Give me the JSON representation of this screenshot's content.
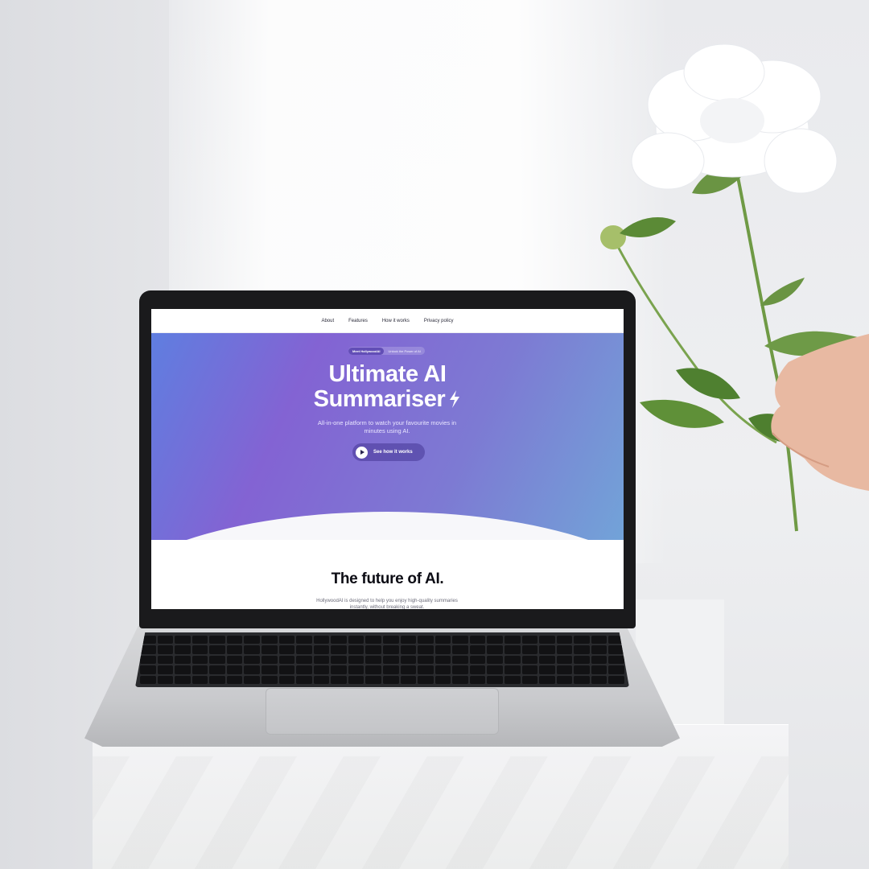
{
  "nav": {
    "items": [
      "About",
      "Features",
      "How it works",
      "Privacy policy"
    ]
  },
  "hero": {
    "badge_pill": "Meet HollywoodAI",
    "badge_text": "Unlock the Power of AI",
    "title_line1": "Ultimate AI",
    "title_line2": "Summariser",
    "subtitle": "All-in-one platform to watch your favourite movies in minutes using AI.",
    "cta_label": "See how it works"
  },
  "section": {
    "title": "The future of AI.",
    "text": "HollywoodAI is designed to help you enjoy high-quality summaries instantly, without breaking a sweat."
  },
  "colors": {
    "hero_start": "#5f7ee0",
    "hero_mid": "#8363d3",
    "hero_end": "#72a3d8",
    "text_dark": "#0c0c14"
  },
  "icons": {
    "bolt": "lightning-bolt-icon",
    "play": "play-icon"
  }
}
